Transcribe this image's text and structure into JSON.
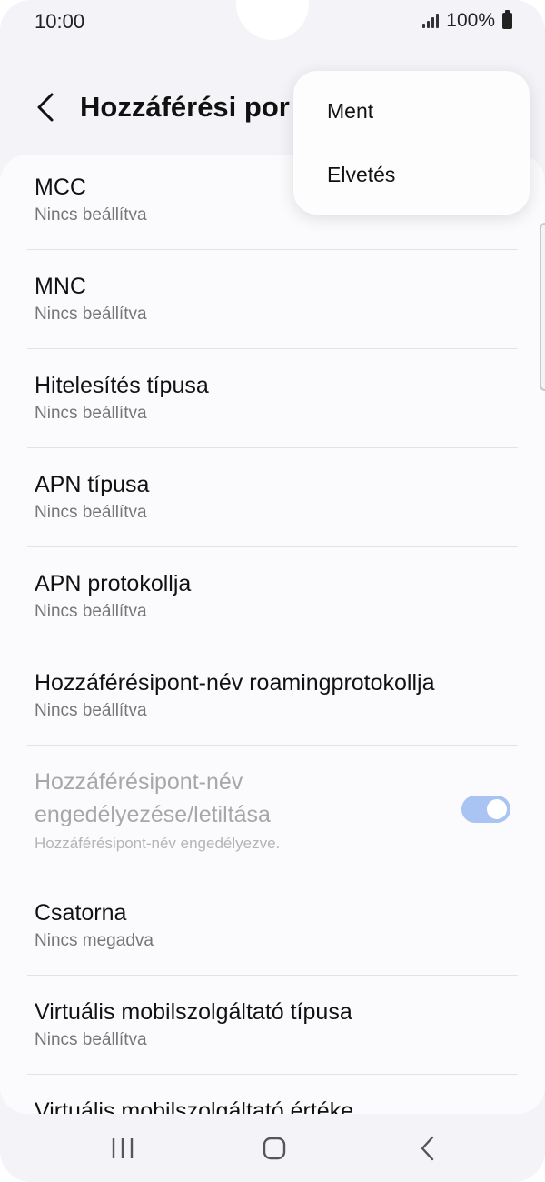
{
  "status_bar": {
    "time": "10:00",
    "battery": "100%"
  },
  "app_bar": {
    "title": "Hozzáférési por"
  },
  "menu": {
    "items": [
      {
        "label": "Ment"
      },
      {
        "label": "Elvetés"
      }
    ]
  },
  "settings": [
    {
      "label": "MCC",
      "value": "Nincs beállítva"
    },
    {
      "label": "MNC",
      "value": "Nincs beállítva"
    },
    {
      "label": "Hitelesítés típusa",
      "value": "Nincs beállítva"
    },
    {
      "label": "APN típusa",
      "value": "Nincs beállítva"
    },
    {
      "label": "APN protokollja",
      "value": "Nincs beállítva"
    },
    {
      "label": "Hozzáférésipont-név roamingprotokollja",
      "value": "Nincs beállítva"
    },
    {
      "label_line1": "Hozzáférésipont-név",
      "label_line2": "engedélyezése/letiltása",
      "value": "Hozzáférésipont-név engedélyezve.",
      "toggle_on": true
    },
    {
      "label": "Csatorna",
      "value": "Nincs megadva"
    },
    {
      "label": "Virtuális mobilszolgáltató típusa",
      "value": "Nincs beállítva"
    },
    {
      "label": "Virtuális mobilszolgáltató értéke"
    }
  ],
  "colors": {
    "accent_toggle": "#a9c3f2",
    "background": "#f4f4f8",
    "card": "#fbfbfd"
  },
  "nav": {
    "icons": [
      "recent-apps-icon",
      "home-icon",
      "back-icon"
    ]
  }
}
